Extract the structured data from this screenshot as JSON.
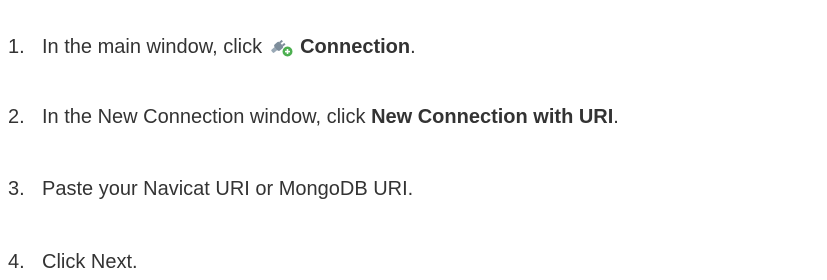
{
  "steps": [
    {
      "number": "1",
      "text_before": "In the main window, click",
      "icon": "connection-plug-icon",
      "bold": "Connection",
      "text_after": "."
    },
    {
      "number": "2",
      "text_before": "In the New Connection window, click",
      "bold": "New Connection with URI",
      "text_after": "."
    },
    {
      "number": "3",
      "text": "Paste your Navicat URI or MongoDB URI."
    },
    {
      "number": "4",
      "text": "Click Next."
    }
  ],
  "colors": {
    "text": "#333333",
    "icon_plug": "#8a9aa8",
    "icon_badge": "#4caf50"
  }
}
